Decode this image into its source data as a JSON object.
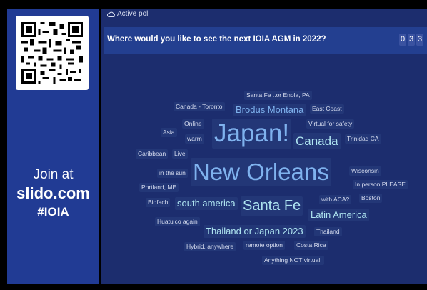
{
  "sidebar": {
    "join_line1": "Join at",
    "join_line2": "slido.com",
    "join_line3": "#IOIA"
  },
  "poll": {
    "status": "Active poll",
    "question": "Where would you like to see the next IOIA AGM in 2022?",
    "counter_digits": [
      "0",
      "3",
      "3"
    ]
  },
  "wordcloud": [
    {
      "text": "Santa Fe ..or Enola, PA"
    },
    {
      "text": "Canada - Toronto"
    },
    {
      "text": "Brodus Montana"
    },
    {
      "text": "East Coast"
    },
    {
      "text": "Online"
    },
    {
      "text": "Virtual for safety"
    },
    {
      "text": "Asia"
    },
    {
      "text": "warm"
    },
    {
      "text": "Japan!"
    },
    {
      "text": "Canada"
    },
    {
      "text": "Trinidad CA"
    },
    {
      "text": "Caribbean"
    },
    {
      "text": "Live"
    },
    {
      "text": "in the sun"
    },
    {
      "text": "New Orleans"
    },
    {
      "text": "Wisconsin"
    },
    {
      "text": "Portland, ME"
    },
    {
      "text": "In person PLEASE"
    },
    {
      "text": "Biofach"
    },
    {
      "text": "south america"
    },
    {
      "text": "Santa Fe"
    },
    {
      "text": "with ACA?"
    },
    {
      "text": "Boston"
    },
    {
      "text": "Latin America"
    },
    {
      "text": "Huatulco again"
    },
    {
      "text": "Thailand or Japan 2023"
    },
    {
      "text": "Thailand"
    },
    {
      "text": "Hybrid, anywhere"
    },
    {
      "text": "remote option"
    },
    {
      "text": "Costa Rica"
    },
    {
      "text": "Anything NOT virtual!"
    }
  ]
}
